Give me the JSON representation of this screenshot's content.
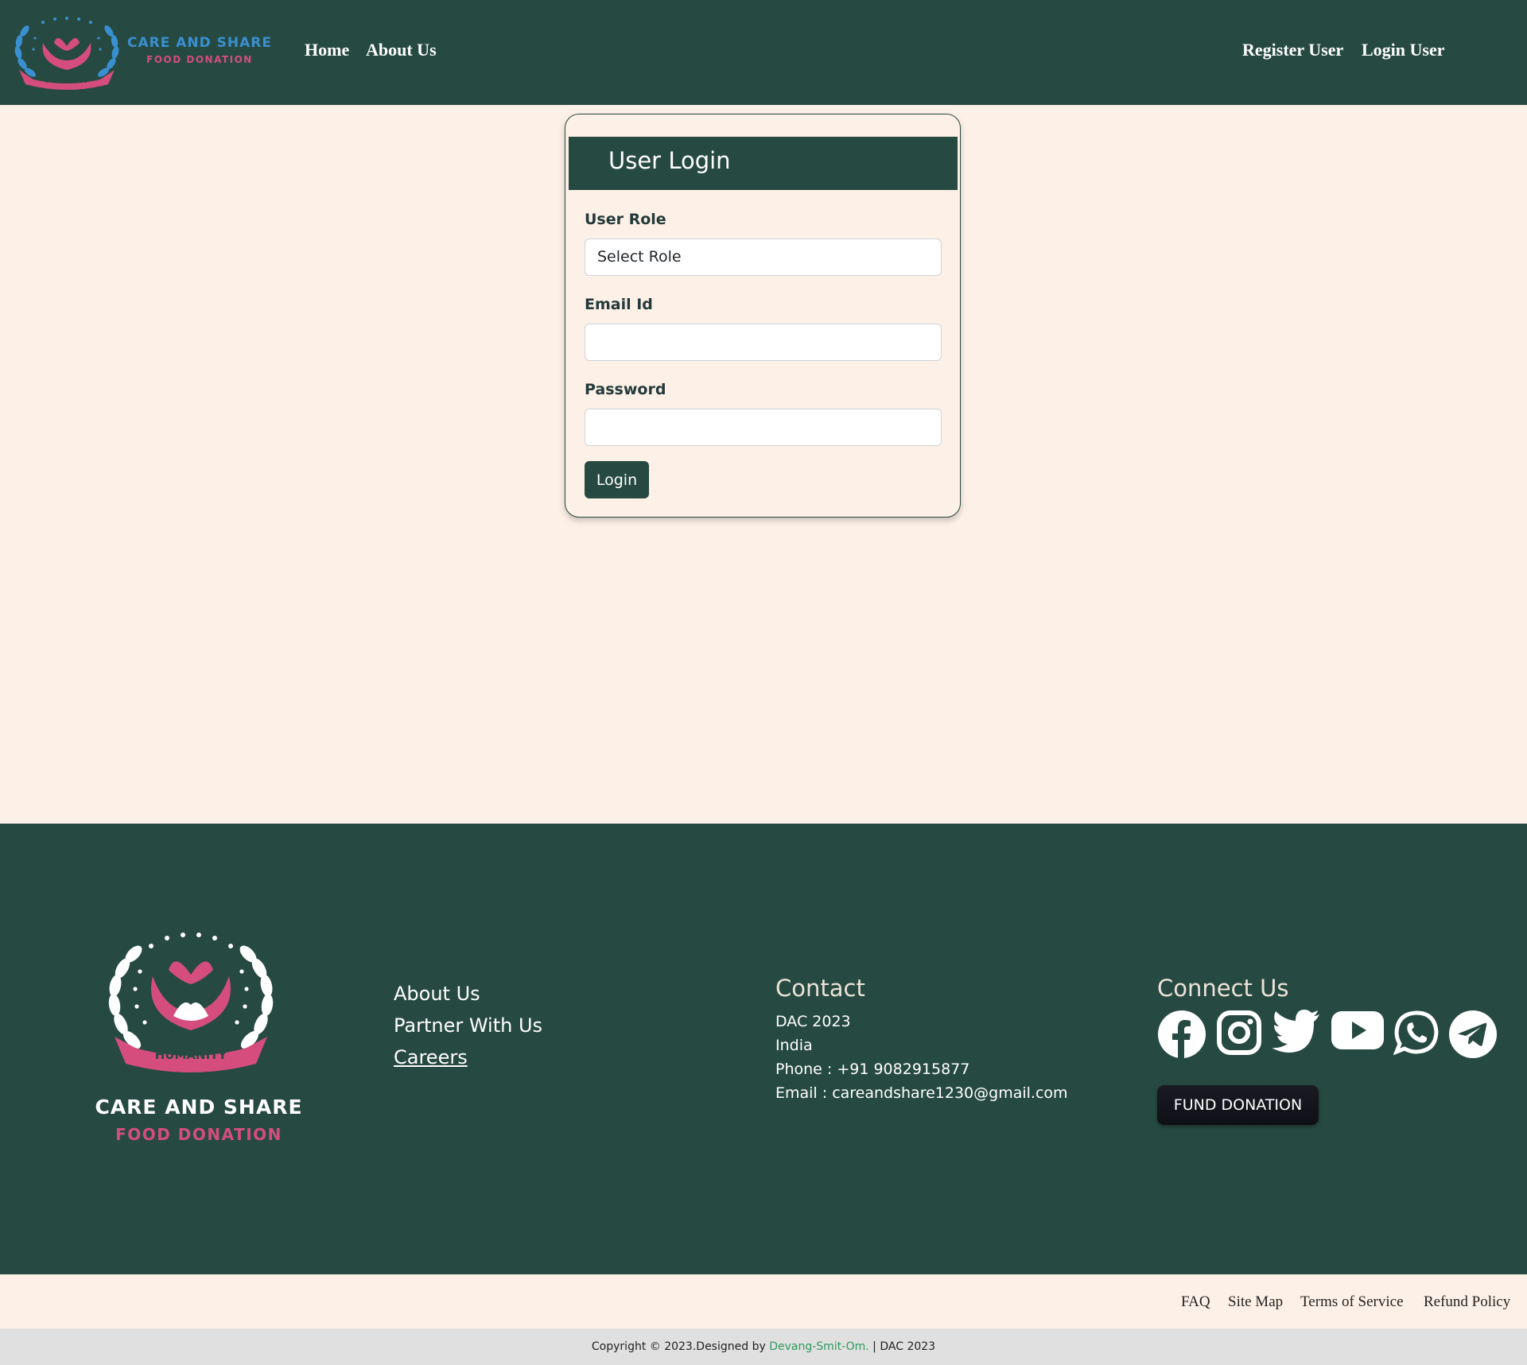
{
  "navbar": {
    "brand_title": "CARE AND SHARE",
    "brand_subtitle": "FOOD DONATION",
    "logo_ribbon": "HUMANITY",
    "links": [
      "Home",
      "About Us"
    ],
    "auth_links": [
      "Register User",
      "Login User"
    ]
  },
  "login_card": {
    "title": "User Login",
    "role_label": "User Role",
    "role_selected": "Select Role",
    "email_label": "Email Id",
    "email_value": "",
    "password_label": "Password",
    "password_value": "",
    "submit_label": "Login"
  },
  "footer": {
    "brand_title": "CARE AND SHARE",
    "brand_subtitle": "FOOD DONATION",
    "logo_ribbon": "HUMANITY",
    "links": [
      "About Us",
      "Partner With Us",
      "Careers"
    ],
    "contact": {
      "heading": "Contact",
      "line1": "DAC 2023",
      "line2": "India",
      "phone": "Phone : +91 9082915877",
      "email": "Email : careandshare1230@gmail.com"
    },
    "connect": {
      "heading": "Connect Us",
      "icons": [
        "facebook-icon",
        "instagram-icon",
        "twitter-icon",
        "youtube-icon",
        "whatsapp-icon",
        "telegram-icon"
      ],
      "fund_button": "FUND DONATION"
    }
  },
  "legal_links": [
    "FAQ",
    "Site Map",
    "Terms of Service",
    "Refund Policy"
  ],
  "copyright": {
    "prefix": "Copyright © 2023.Designed by ",
    "author": "Devang-Smit-Om.",
    "suffix": " | DAC 2023"
  },
  "colors": {
    "primary": "#264a41",
    "background": "#fdf0e6",
    "accent_pink": "#d44d7c",
    "accent_blue": "#3a8fd0"
  }
}
